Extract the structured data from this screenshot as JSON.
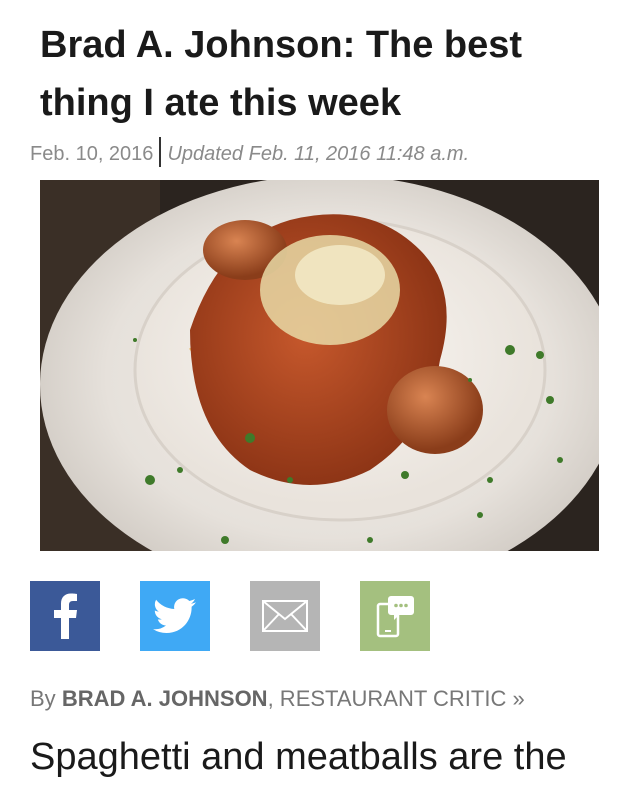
{
  "article": {
    "headline": "Brad A. Johnson: The best thing I ate this week",
    "published": "Feb. 10, 2016",
    "updated": "Updated Feb. 11, 2016 11:48 a.m.",
    "lead": "Spaghetti and meatballs are the"
  },
  "share": {
    "facebook_icon": "facebook-icon",
    "twitter_icon": "twitter-icon",
    "email_icon": "envelope-icon",
    "sms_icon": "phone-chat-icon",
    "colors": {
      "facebook": "#3b5998",
      "twitter": "#3fa9f5",
      "email": "#b5b5b5",
      "sms": "#a4c07f"
    }
  },
  "byline": {
    "prefix": "By",
    "author": "BRAD A. JOHNSON",
    "role": ", RESTAURANT CRITIC »"
  }
}
